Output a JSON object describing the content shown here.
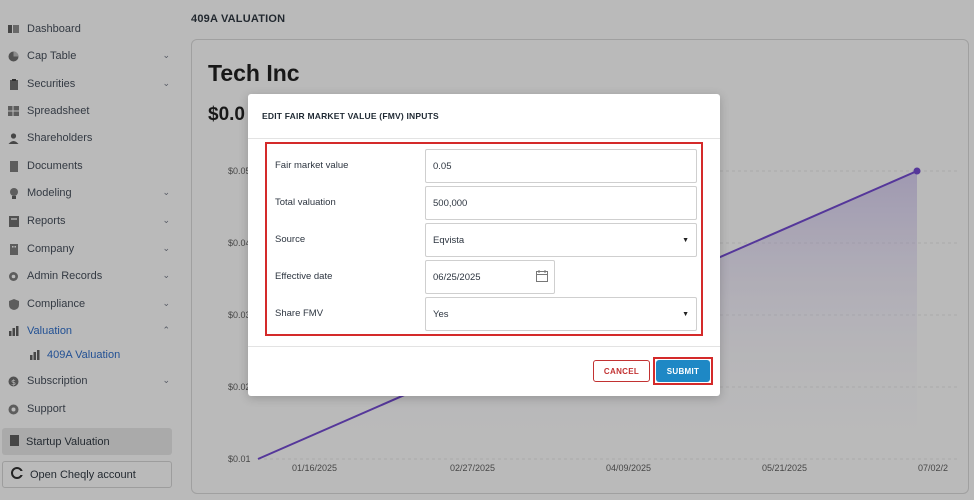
{
  "sidebar": {
    "items": [
      {
        "label": "Dashboard",
        "icon": "dashboard-icon"
      },
      {
        "label": "Cap Table",
        "icon": "pie-chart-icon"
      },
      {
        "label": "Securities",
        "icon": "clipboard-icon"
      },
      {
        "label": "Spreadsheet",
        "icon": "spreadsheet-icon"
      },
      {
        "label": "Shareholders",
        "icon": "user-icon"
      },
      {
        "label": "Documents",
        "icon": "document-icon"
      },
      {
        "label": "Modeling",
        "icon": "lightbulb-icon"
      },
      {
        "label": "Reports",
        "icon": "report-icon"
      },
      {
        "label": "Company",
        "icon": "building-icon"
      },
      {
        "label": "Admin Records",
        "icon": "gear-icon"
      },
      {
        "label": "Compliance",
        "icon": "shield-icon"
      },
      {
        "label": "Valuation",
        "icon": "bar-chart-icon"
      },
      {
        "label": "Subscription",
        "icon": "dollar-icon"
      },
      {
        "label": "Support",
        "icon": "support-icon"
      }
    ],
    "sub_item": "409A Valuation",
    "startup_valuation": "Startup Valuation",
    "open_account": "Open Cheqly account"
  },
  "page": {
    "title": "409A VALUATION",
    "company": "Tech Inc",
    "price": "$0.0"
  },
  "chart_data": {
    "type": "area",
    "x": [
      "01/16/2025",
      "02/27/2025",
      "04/09/2025",
      "05/21/2025",
      "07/02/2"
    ],
    "y_ticks": [
      "$0.05",
      "$0.04",
      "$0.03",
      "$0.02",
      "$0.01"
    ],
    "line_color": "#6a3fd0"
  },
  "modal": {
    "title": "EDIT FAIR MARKET VALUE (FMV) INPUTS",
    "fields": {
      "fmv": {
        "label": "Fair market value",
        "value": "0.05"
      },
      "total_valuation": {
        "label": "Total valuation",
        "value": "500,000"
      },
      "source": {
        "label": "Source",
        "value": "Eqvista"
      },
      "effective_date": {
        "label": "Effective date",
        "value": "06/25/2025"
      },
      "share_fmv": {
        "label": "Share FMV",
        "value": "Yes"
      }
    },
    "cancel_label": "CANCEL",
    "submit_label": "SUBMIT"
  },
  "colors": {
    "accent": "#1f64c7",
    "submit": "#1e88c5",
    "cancel": "#c23232",
    "highlight": "#d42a2a"
  }
}
